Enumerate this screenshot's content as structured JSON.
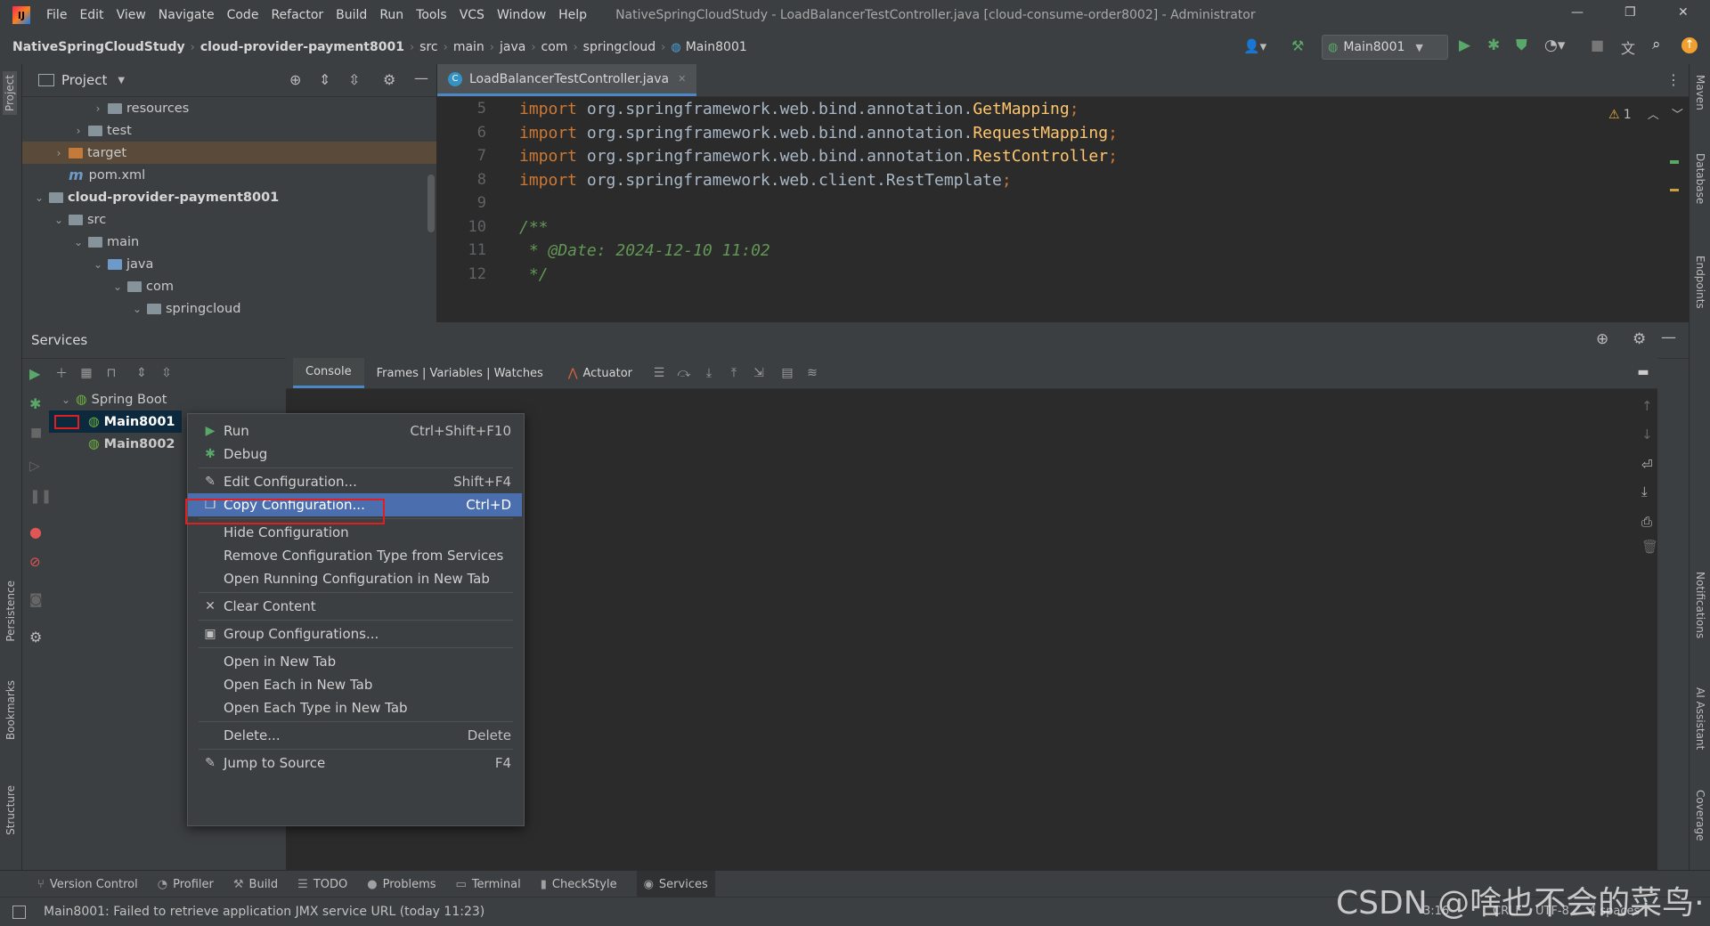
{
  "titlebar": {
    "menu": [
      "File",
      "Edit",
      "View",
      "Navigate",
      "Code",
      "Refactor",
      "Build",
      "Run",
      "Tools",
      "VCS",
      "Window",
      "Help"
    ],
    "title": "NativeSpringCloudStudy - LoadBalancerTestController.java [cloud-consume-order8002] - Administrator",
    "min": "—",
    "restore": "❐",
    "close": "✕"
  },
  "navbar": {
    "crumbs": [
      "NativeSpringCloudStudy",
      "cloud-provider-payment8001",
      "src",
      "main",
      "java",
      "com",
      "springcloud",
      "Main8001"
    ],
    "run_config": "Main8001"
  },
  "leftstripe": {
    "project": "Project",
    "persistence": "Persistence",
    "bookmarks": "Bookmarks",
    "structure": "Structure"
  },
  "rightstripe": {
    "maven": "Maven",
    "database": "Database",
    "endpoints": "Endpoints",
    "notifications": "Notifications",
    "ai": "AI Assistant",
    "coverage": "Coverage"
  },
  "project": {
    "title": "Project",
    "tree": [
      {
        "label": "resources",
        "depth": 4,
        "arrow": "›",
        "color": "gray"
      },
      {
        "label": "test",
        "depth": 3,
        "arrow": "›",
        "color": "gray"
      },
      {
        "label": "target",
        "depth": 2,
        "arrow": "›",
        "color": "orange"
      },
      {
        "label": "pom.xml",
        "depth": 2,
        "arrow": "",
        "color": "m"
      },
      {
        "label": "cloud-provider-payment8001",
        "depth": 1,
        "arrow": "⌄",
        "color": "gray",
        "bold": true
      },
      {
        "label": "src",
        "depth": 2,
        "arrow": "⌄",
        "color": "gray"
      },
      {
        "label": "main",
        "depth": 3,
        "arrow": "⌄",
        "color": "gray"
      },
      {
        "label": "java",
        "depth": 4,
        "arrow": "⌄",
        "color": "blue"
      },
      {
        "label": "com",
        "depth": 5,
        "arrow": "⌄",
        "color": "gray"
      },
      {
        "label": "springcloud",
        "depth": 6,
        "arrow": "⌄",
        "color": "gray"
      }
    ]
  },
  "editor": {
    "tab": "LoadBalancerTestController.java",
    "tab_close": "✕",
    "warnings": "1",
    "lines": [
      {
        "n": "5",
        "kw": "import ",
        "pkg": "org.springframework.web.bind.annotation.",
        "cls": "GetMapping",
        "end": ";"
      },
      {
        "n": "6",
        "kw": "import ",
        "pkg": "org.springframework.web.bind.annotation.",
        "cls": "RequestMapping",
        "end": ";"
      },
      {
        "n": "7",
        "kw": "import ",
        "pkg": "org.springframework.web.bind.annotation.",
        "cls": "RestController",
        "end": ";"
      },
      {
        "n": "8",
        "kw": "import ",
        "pkg": "org.springframework.web.client.RestTemplate",
        "cls": "",
        "end": ";"
      },
      {
        "n": "9",
        "kw": "",
        "pkg": "",
        "cls": "",
        "end": ""
      },
      {
        "n": "10",
        "comment": "/**"
      },
      {
        "n": "11",
        "comment": " * @Date: 2024-12-10 11:02"
      },
      {
        "n": "12",
        "comment": " */"
      }
    ]
  },
  "services": {
    "title": "Services",
    "tree": {
      "root": "Spring Boot",
      "items": [
        "Main8001",
        "Main8002"
      ]
    },
    "console_tabs": [
      "Console",
      "Frames | Variables | Watches",
      "Actuator"
    ]
  },
  "context_menu": {
    "items": [
      {
        "label": "Run",
        "shortcut": "Ctrl+Shift+F10",
        "icon": "▶",
        "icon_color": "#59a869"
      },
      {
        "label": "Debug",
        "shortcut": "",
        "icon": "✱",
        "icon_color": "#59a869"
      },
      {
        "label": "Edit Configuration...",
        "shortcut": "Shift+F4",
        "icon": "✎",
        "icon_color": "#c0c0c0"
      },
      {
        "label": "Copy Configuration...",
        "shortcut": "Ctrl+D",
        "icon": "❐",
        "icon_color": "#dcdcdc",
        "selected": true
      },
      {
        "label": "Hide Configuration",
        "shortcut": "",
        "icon": ""
      },
      {
        "label": "Remove Configuration Type from Services",
        "shortcut": "",
        "icon": ""
      },
      {
        "label": "Open Running Configuration in New Tab",
        "shortcut": "",
        "icon": ""
      },
      {
        "label": "Clear Content",
        "shortcut": "",
        "icon": "✕",
        "icon_color": "#c0c0c0"
      },
      {
        "label": "Group Configurations...",
        "shortcut": "",
        "icon": "▣",
        "icon_color": "#c0c0c0"
      },
      {
        "label": "Open in New Tab",
        "shortcut": "",
        "icon": ""
      },
      {
        "label": "Open Each in New Tab",
        "shortcut": "",
        "icon": ""
      },
      {
        "label": "Open Each Type in New Tab",
        "shortcut": "",
        "icon": ""
      },
      {
        "label": "Delete...",
        "shortcut": "Delete",
        "icon": ""
      },
      {
        "label": "Jump to Source",
        "shortcut": "F4",
        "icon": "✎",
        "icon_color": "#c0c0c0"
      }
    ]
  },
  "bottombar": {
    "tabs": [
      {
        "label": "Version Control",
        "icon": "⑂"
      },
      {
        "label": "Profiler",
        "icon": "◔"
      },
      {
        "label": "Build",
        "icon": "⚒"
      },
      {
        "label": "TODO",
        "icon": "☰"
      },
      {
        "label": "Problems",
        "icon": "●"
      },
      {
        "label": "Terminal",
        "icon": "▭"
      },
      {
        "label": "CheckStyle",
        "icon": "▮"
      },
      {
        "label": "Services",
        "icon": "◉",
        "active": true
      }
    ]
  },
  "statusbar": {
    "message": "Main8001: Failed to retrieve application JMX service URL (today 11:23)",
    "position": "3:16",
    "line_sep": "CRLF",
    "encoding": "UTF-8",
    "indent": "4 spaces"
  },
  "watermark": "CSDN @啥也不会的菜鸟·"
}
